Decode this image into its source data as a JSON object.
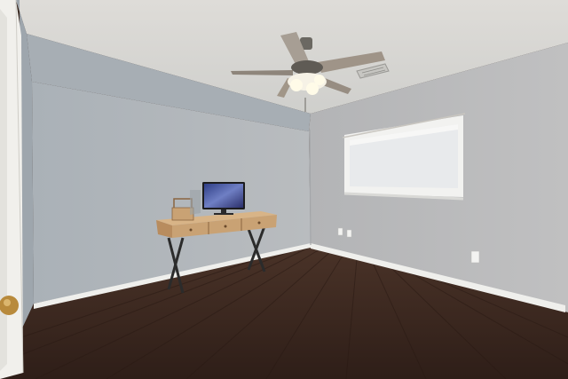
{
  "scene": {
    "subject": "empty-room-with-desk-and-ceiling-fan",
    "colors": {
      "ceiling": "#d9d8d4",
      "wall_left": "#b2b8bd",
      "wall_back": "#b7b8ba",
      "wall_right": "#b9b9bb",
      "floor": "#3f2b23",
      "baseboard": "#efefec",
      "door_frame": "#f1f0ec",
      "desk_wood": "#c9a274",
      "desk_legs": "#2b2b2b",
      "monitor_screen": "#4f5fa6",
      "window_shade": "#e8eaec"
    },
    "icons": {
      "ceiling_fan": "ceiling-fan-icon",
      "air_vent": "air-vent-icon",
      "outlet": "wall-outlet-icon",
      "door_knob": "door-knob-icon"
    }
  }
}
